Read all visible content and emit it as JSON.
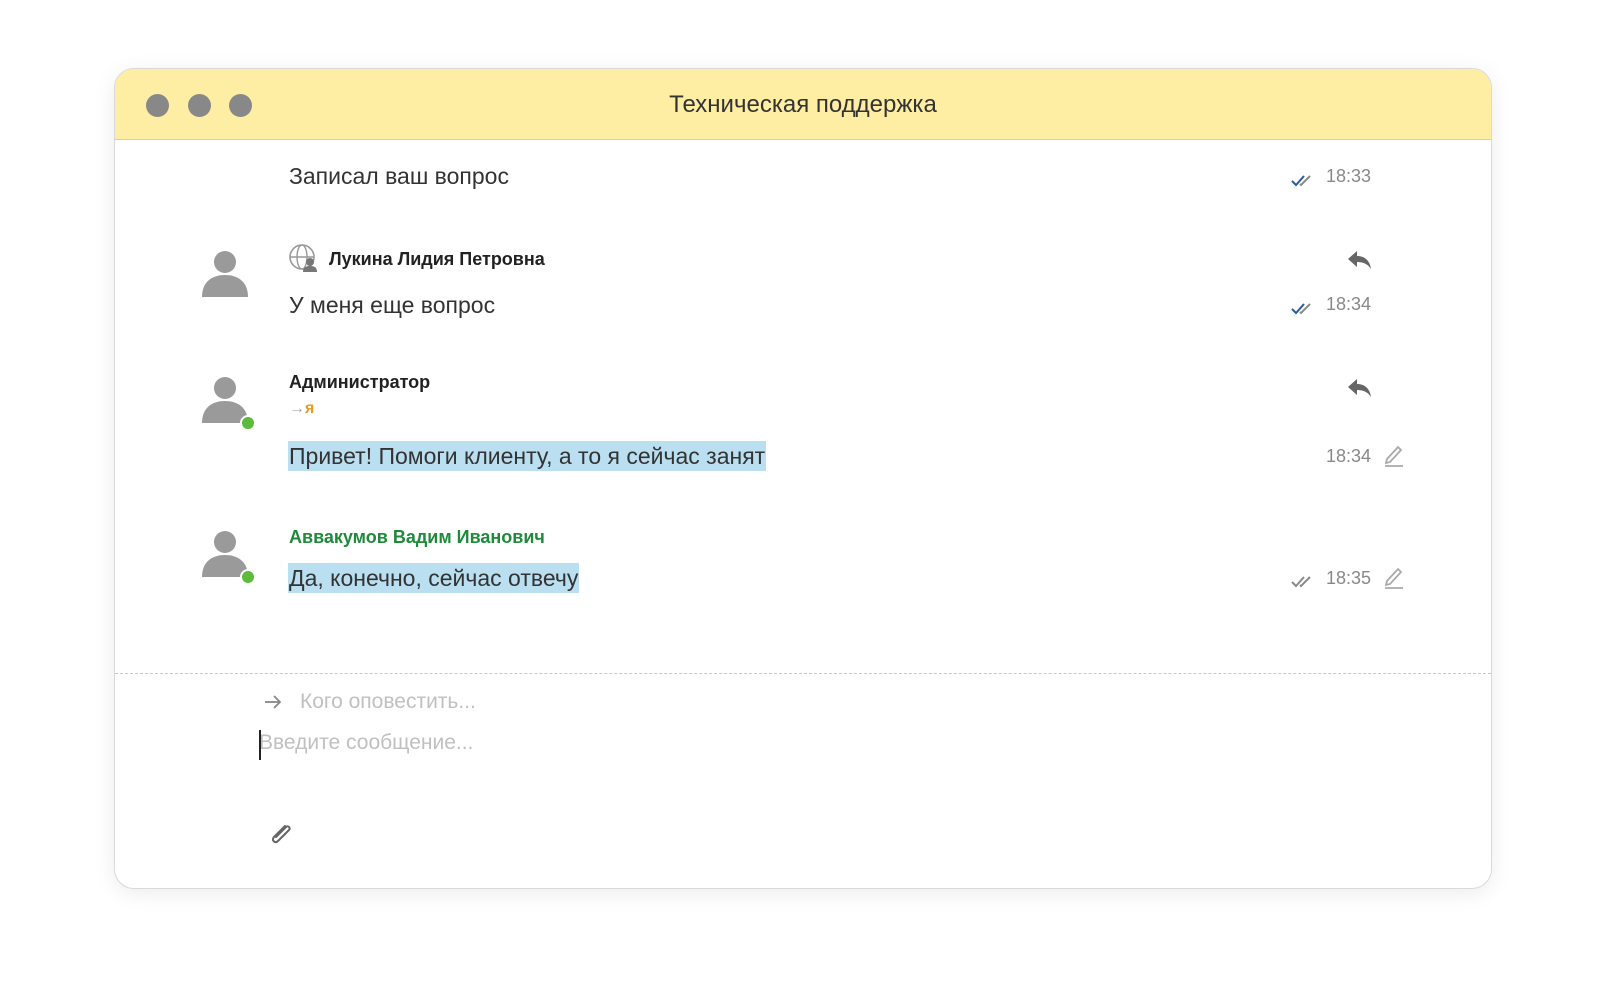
{
  "window": {
    "title": "Техническая поддержка"
  },
  "messages": [
    {
      "sender": "",
      "text": "Записал ваш вопрос",
      "time": "18:33",
      "status": "read"
    },
    {
      "sender": "Лукина Лидия Петровна",
      "text": "У меня еще вопрос",
      "time": "18:34",
      "status": "read",
      "sender_icon": "globe-user-icon"
    },
    {
      "sender": "Администратор",
      "recipient": "я",
      "recipient_arrow": "→",
      "text": "Привет! Помоги клиенту, а то я сейчас занят",
      "time": "18:34",
      "online": true
    },
    {
      "sender": "Аввакумов Вадим Иванович",
      "text": "Да, конечно, сейчас отвечу",
      "time": "18:35",
      "status": "delivered",
      "online": true
    }
  ],
  "composer": {
    "notify_placeholder": "Кого оповестить...",
    "message_placeholder": "Введите сообщение..."
  },
  "colors": {
    "titlebar": "#fdeea3",
    "highlight": "#b9dff0",
    "online": "#5bbb3a",
    "sender_green": "#1f8a3b",
    "recipient_orange": "#e69a2e",
    "tick_read": "#2c5aa0",
    "tick_delivered": "#8a8a8a"
  }
}
